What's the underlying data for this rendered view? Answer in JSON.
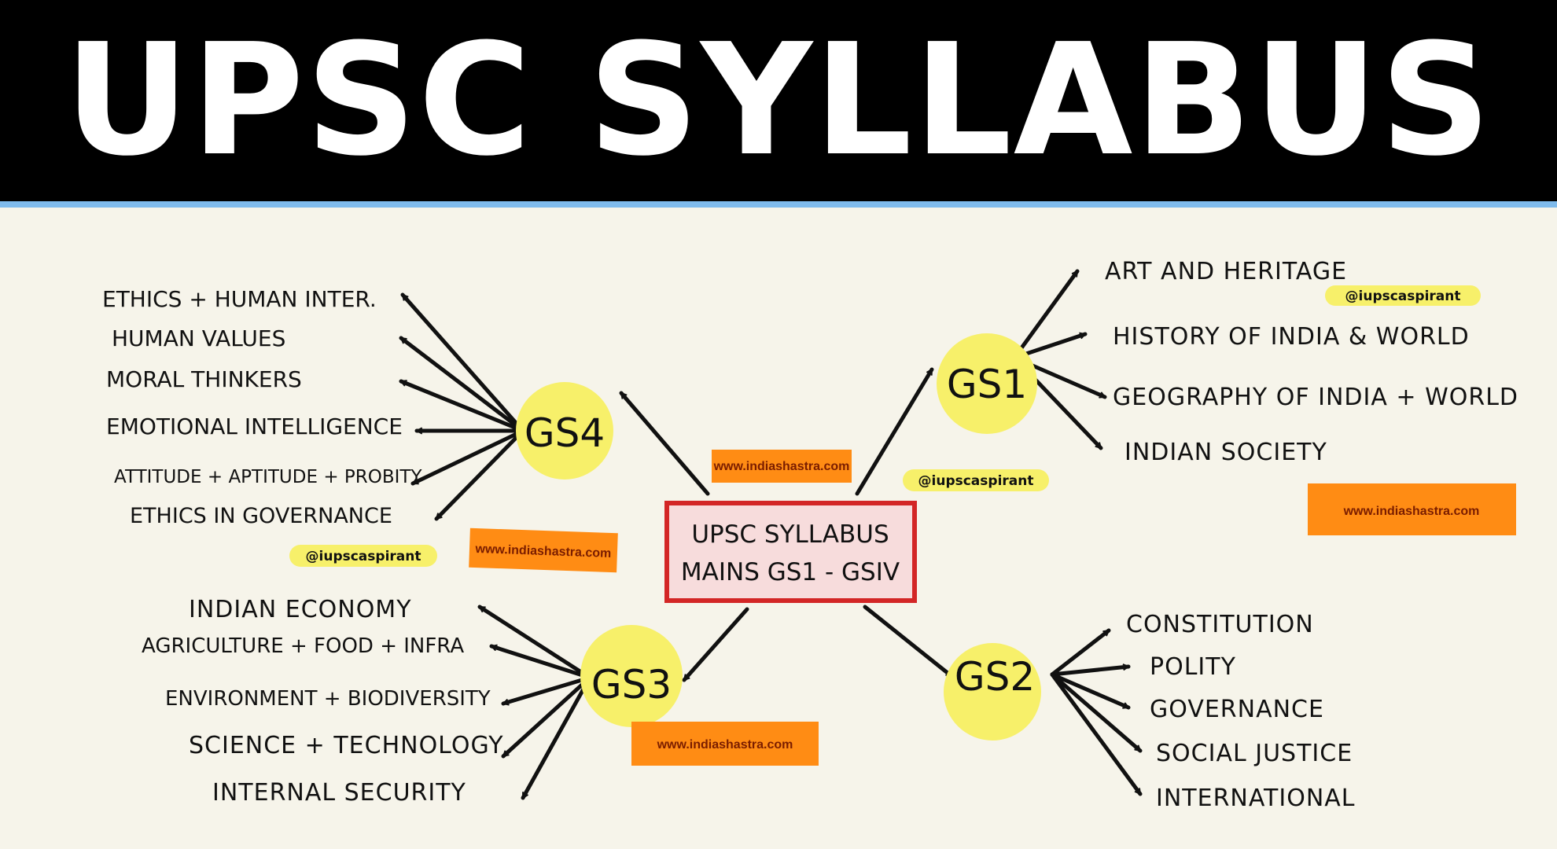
{
  "banner": {
    "title": "UPSC SYLLABUS"
  },
  "center": {
    "line1": "UPSC SYLLABUS",
    "line2": "MAINS GS1 - GSIV"
  },
  "watermark": {
    "handle": "@iupscaspirant",
    "website": "www.indiashastra.com"
  },
  "colors": {
    "banner_bg": "#000000",
    "banner_rule": "#7fbbec",
    "canvas": "#f6f4ea",
    "highlight": "#f7f06a",
    "center_border": "#d32626",
    "center_fill": "#f7dcdc",
    "tag_bg": "#ff8c14"
  },
  "papers": {
    "gs1": {
      "label": "GS1",
      "topics": [
        "ART AND HERITAGE",
        "HISTORY OF INDIA & WORLD",
        "GEOGRAPHY OF INDIA + WORLD",
        "INDIAN SOCIETY"
      ]
    },
    "gs2": {
      "label": "GS2",
      "topics": [
        "CONSTITUTION",
        "POLITY",
        "GOVERNANCE",
        "SOCIAL JUSTICE",
        "INTERNATIONAL"
      ]
    },
    "gs3": {
      "label": "GS3",
      "topics": [
        "INDIAN ECONOMY",
        "AGRICULTURE + FOOD + INFRA",
        "ENVIRONMENT + BIODIVERSITY",
        "SCIENCE + TECHNOLOGY",
        "INTERNAL SECURITY"
      ]
    },
    "gs4": {
      "label": "GS4",
      "topics": [
        "ETHICS + HUMAN INTER.",
        "HUMAN VALUES",
        "MORAL THINKERS",
        "EMOTIONAL INTELLIGENCE",
        "ATTITUDE + APTITUDE + PROBITY",
        "ETHICS IN GOVERNANCE"
      ]
    }
  }
}
